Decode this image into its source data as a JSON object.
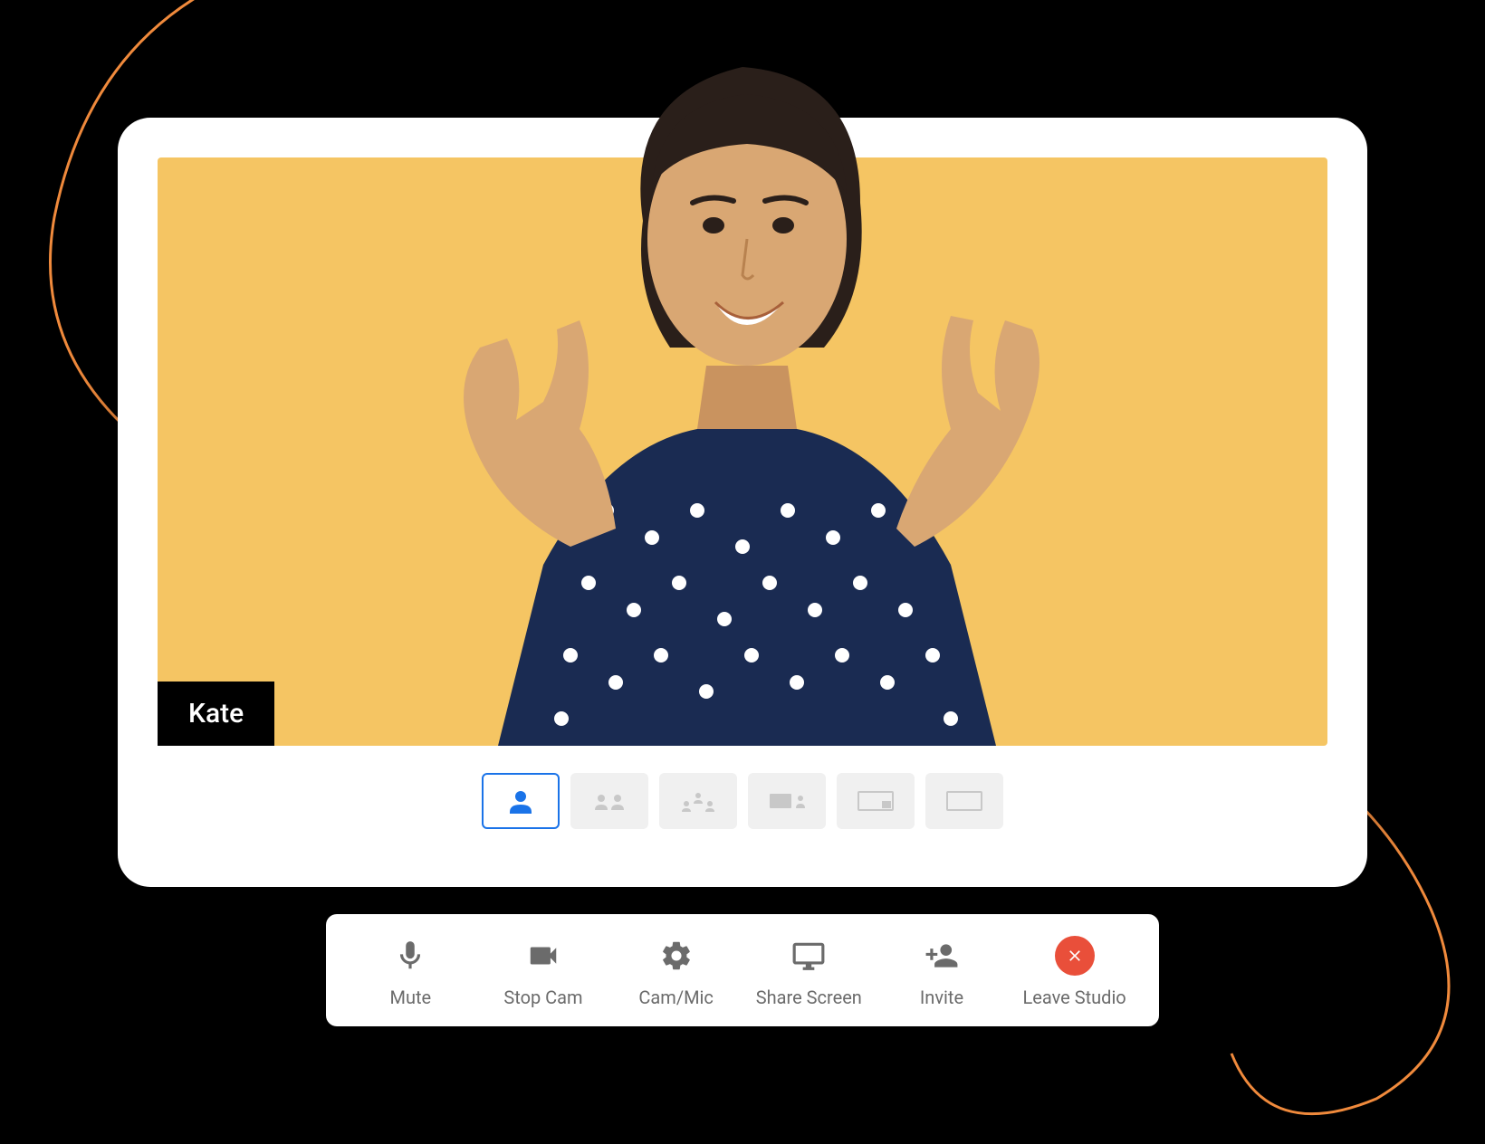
{
  "participant": {
    "name": "Kate"
  },
  "layouts": [
    {
      "id": "single",
      "active": true
    },
    {
      "id": "two-up",
      "active": false
    },
    {
      "id": "three-up",
      "active": false
    },
    {
      "id": "screen-small",
      "active": false
    },
    {
      "id": "screen-large",
      "active": false
    },
    {
      "id": "full-screen",
      "active": false
    }
  ],
  "controls": {
    "mute": {
      "label": "Mute",
      "icon": "microphone-icon"
    },
    "stopCam": {
      "label": "Stop Cam",
      "icon": "camera-icon"
    },
    "camMic": {
      "label": "Cam/Mic",
      "icon": "gear-icon"
    },
    "shareScreen": {
      "label": "Share Screen",
      "icon": "monitor-icon"
    },
    "invite": {
      "label": "Invite",
      "icon": "add-user-icon"
    },
    "leave": {
      "label": "Leave Studio",
      "icon": "close-icon"
    }
  },
  "colors": {
    "videoBackground": "#f5c563",
    "accent": "#1a73e8",
    "leave": "#e94f3a",
    "swirl": "#f08a3c"
  }
}
